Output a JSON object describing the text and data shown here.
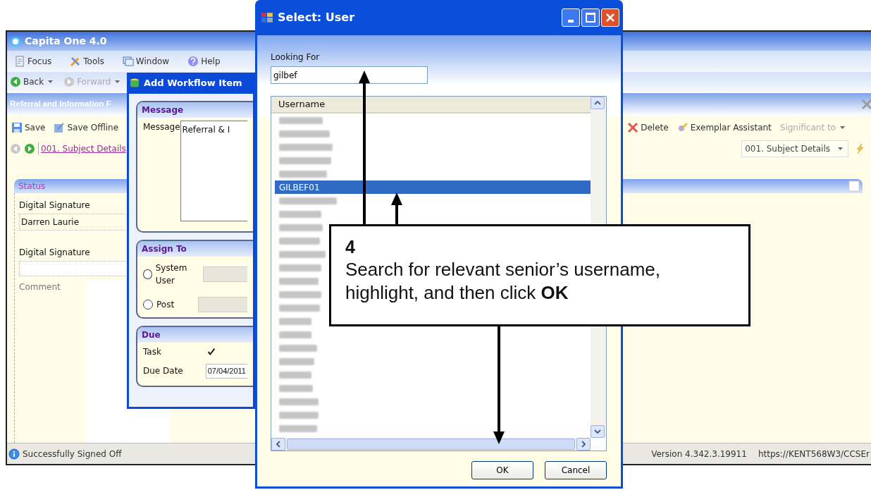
{
  "main_window": {
    "title": "Capita One 4.0",
    "menu": [
      {
        "label": "Focus"
      },
      {
        "label": "Tools"
      },
      {
        "label": "Window"
      },
      {
        "label": "Help"
      }
    ],
    "nav": [
      {
        "label": "Back",
        "disabled": false
      },
      {
        "label": "Forward",
        "disabled": true
      }
    ],
    "page_title": "Referral and Information F",
    "toolbar_left": [
      {
        "label": "Save",
        "disabled": false
      },
      {
        "label": "Save Offline",
        "disabled": false
      }
    ],
    "toolbar_right": [
      {
        "label": "Delete",
        "disabled": false
      },
      {
        "label": "Exemplar Assistant",
        "disabled": false
      },
      {
        "label": "Significant to",
        "disabled": true
      }
    ],
    "section_link": "001. Subject Details",
    "section_select": "001. Subject Details",
    "status_panel": {
      "title": "Status",
      "checked": false,
      "signed_label": "Digital Signature",
      "signed_value": "Darren Laurie",
      "signature_label": "Digital Signature",
      "comment_label": "Comment"
    },
    "status_bar": {
      "message": "Successfully Signed Off",
      "version": "Version 4.342.3.19911",
      "url": "https://KENT568W3/CCSEr"
    }
  },
  "workflow_dialog": {
    "title": "Add Workflow Item",
    "message_group": {
      "title": "Message",
      "label": "Message",
      "value": "Referral & I"
    },
    "assign_group": {
      "title": "Assign To",
      "options": [
        {
          "label": "System User",
          "selected": false
        },
        {
          "label": "Post",
          "selected": false
        }
      ]
    },
    "due_group": {
      "title": "Due",
      "task_label": "Task",
      "task_checked": true,
      "date_label": "Due Date",
      "date_value": "07/04/2011"
    }
  },
  "select_dialog": {
    "title": "Select: User",
    "search_label": "Looking For",
    "search_value": "gilbef",
    "column": "Username",
    "rows": [
      {
        "kind": "blurred",
        "selected": false
      },
      {
        "kind": "blurred",
        "selected": false
      },
      {
        "kind": "blurred",
        "selected": false
      },
      {
        "kind": "blurred",
        "selected": false
      },
      {
        "kind": "blurred",
        "selected": false
      },
      {
        "kind": "text",
        "username": "GILBEF01",
        "selected": true
      },
      {
        "kind": "blurred",
        "selected": false
      },
      {
        "kind": "blurred",
        "selected": false
      },
      {
        "kind": "blurred",
        "selected": false
      },
      {
        "kind": "blurred",
        "selected": false
      },
      {
        "kind": "blurred",
        "selected": false
      },
      {
        "kind": "blurred",
        "selected": false
      },
      {
        "kind": "blurred",
        "selected": false
      },
      {
        "kind": "blurred",
        "selected": false
      },
      {
        "kind": "blurred",
        "selected": false
      },
      {
        "kind": "blurred",
        "selected": false
      },
      {
        "kind": "blurred",
        "selected": false
      },
      {
        "kind": "blurred",
        "selected": false
      },
      {
        "kind": "blurred",
        "selected": false
      },
      {
        "kind": "blurred",
        "selected": false
      },
      {
        "kind": "blurred",
        "selected": false
      },
      {
        "kind": "blurred",
        "selected": false
      },
      {
        "kind": "blurred",
        "selected": false
      },
      {
        "kind": "blurred",
        "selected": false
      }
    ],
    "buttons": [
      {
        "label": "OK"
      },
      {
        "label": "Cancel"
      }
    ]
  },
  "callout": {
    "number": "4",
    "text": "Search for relevant senior’s username, highlight, and then click **OK**"
  }
}
